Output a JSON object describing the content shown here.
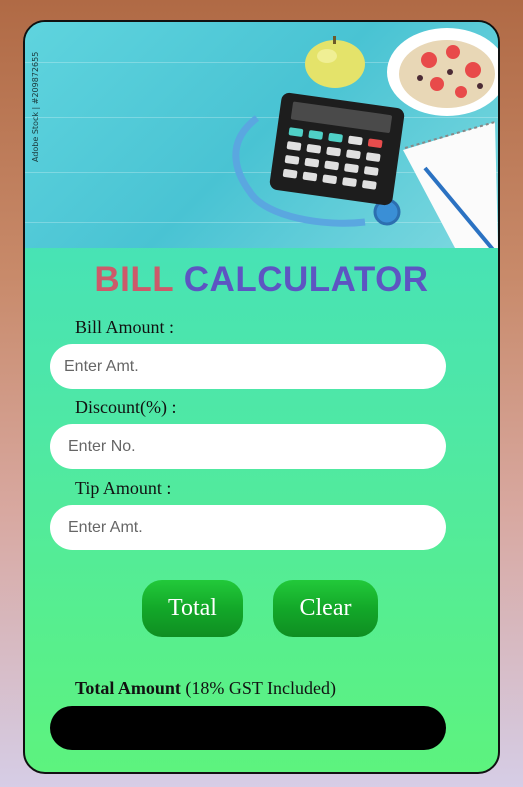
{
  "header": {
    "image_caption": "Adobe Stock | #209872655"
  },
  "title": {
    "word1": "BILL",
    "word2": "CALCULATOR"
  },
  "form": {
    "bill_label": "Bill Amount :",
    "bill_placeholder": "Enter Amt.",
    "discount_label": "Discount(%) :",
    "discount_placeholder": "Enter No.",
    "tip_label": "Tip Amount :",
    "tip_placeholder": "Enter Amt."
  },
  "buttons": {
    "total": "Total",
    "clear": "Clear"
  },
  "result": {
    "label_bold": "Total Amount",
    "label_rest": " (18% GST Included)",
    "value": ""
  },
  "colors": {
    "title_word1": "#cc5a6a",
    "title_word2": "#5d55c2",
    "button": "#13a829",
    "result_bg": "#000000"
  }
}
